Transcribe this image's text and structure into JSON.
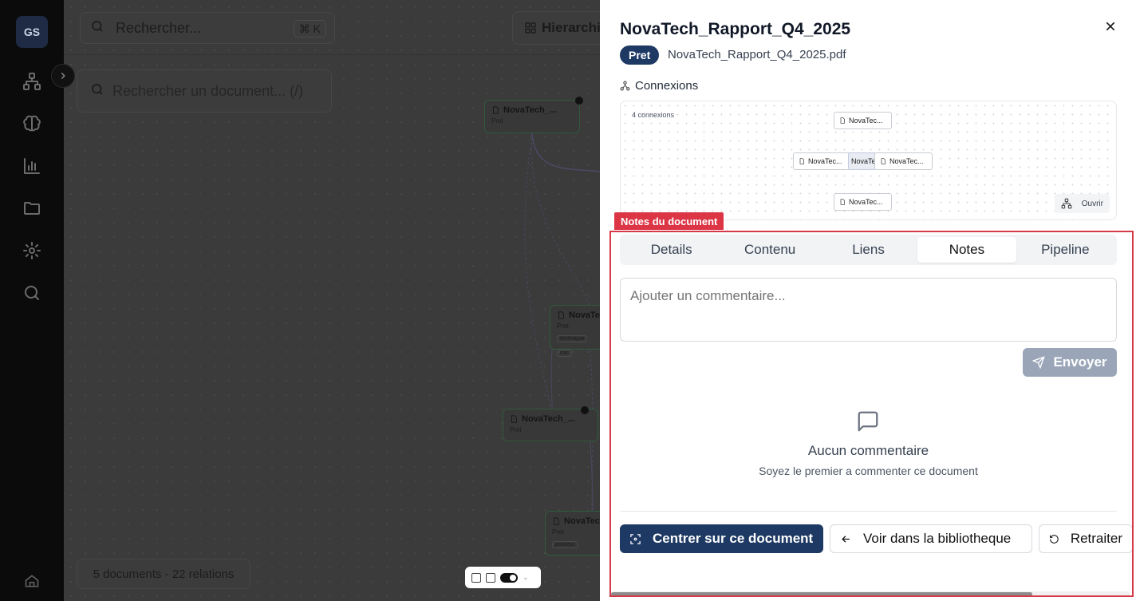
{
  "sidebar": {
    "logo": "GS",
    "items": [
      {
        "icon": "hierarchy-icon"
      },
      {
        "icon": "brain-icon"
      },
      {
        "icon": "bar-chart-icon"
      },
      {
        "icon": "folder-icon"
      },
      {
        "icon": "settings-icon"
      },
      {
        "icon": "search-icon"
      }
    ],
    "bottom_icon": "home-icon"
  },
  "canvas": {
    "search_placeholder": "Rechercher...",
    "search_shortcut": "⌘ K",
    "view_button": "Hierarchie",
    "doc_search_placeholder": "Rechercher un document... (/)",
    "nodes": [
      {
        "title": "NovaTech_...",
        "status": "Pret",
        "tags": []
      },
      {
        "title": "NovaTec",
        "status": "Pret",
        "tags": [
          "technique",
          "cas"
        ]
      },
      {
        "title": "NovaTech_...",
        "status": "Pret",
        "tags": []
      },
      {
        "title": "NovaTec",
        "status": "Pret",
        "tags": [
          "process"
        ]
      }
    ],
    "summary": "5 documents - 22 relations"
  },
  "panel": {
    "title": "NovaTech_Rapport_Q4_2025",
    "status": "Pret",
    "file_name": "NovaTech_Rapport_Q4_2025.pdf",
    "connections_label": "Connexions",
    "connections_count": "4 connexions",
    "graph_nodes": {
      "top": "NovaTec...",
      "left": "NovaTec...",
      "center": "NovaTe",
      "right": "NovaTec...",
      "bottom": "NovaTec..."
    },
    "open_label": "Ouvrir",
    "highlight_label": "Notes du document",
    "tabs": [
      "Details",
      "Contenu",
      "Liens",
      "Notes",
      "Pipeline"
    ],
    "active_tab": "Notes",
    "comment_placeholder": "Ajouter un commentaire...",
    "send_label": "Envoyer",
    "empty_title": "Aucun commentaire",
    "empty_subtitle": "Soyez le premier a commenter ce document",
    "actions": {
      "center": "Centrer sur ce document",
      "library": "Voir dans la bibliotheque",
      "retry": "Retraiter"
    },
    "colors": {
      "primary": "#1e3a64",
      "highlight": "#dc3545",
      "send_disabled": "#9aa6b8"
    }
  }
}
